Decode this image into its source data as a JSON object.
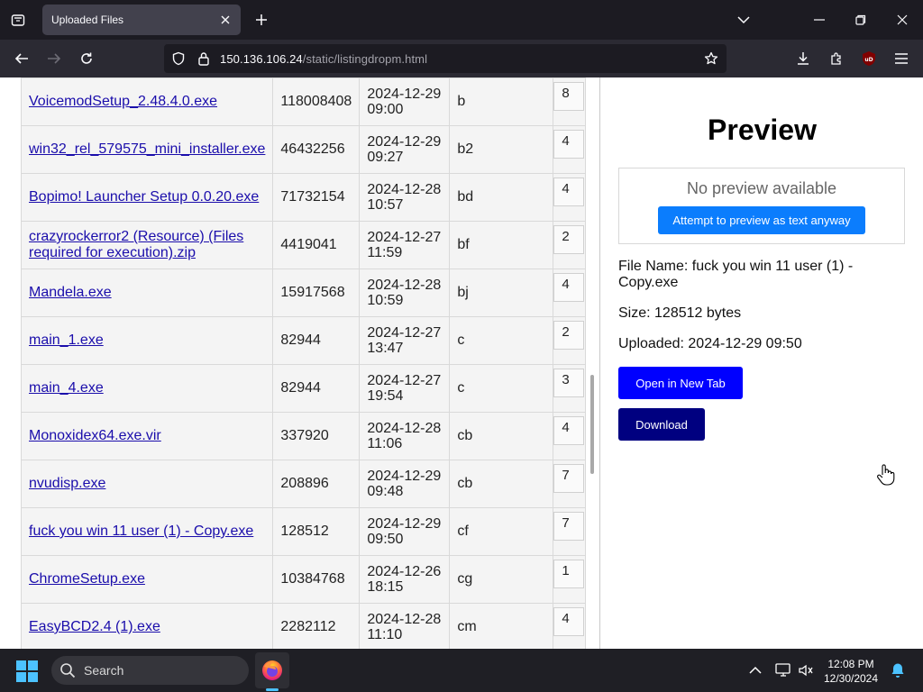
{
  "browser": {
    "tab_title": "Uploaded Files",
    "url_host": "150.136.106.24",
    "url_path": "/static/listingdropm.html"
  },
  "files": [
    {
      "name": "VoicemodSetup_2.48.4.0.exe",
      "size": "118008408",
      "date": "2024-12-29",
      "time": "09:00",
      "tag": "b",
      "count": "8"
    },
    {
      "name": "win32_rel_579575_mini_installer.exe",
      "size": "46432256",
      "date": "2024-12-29",
      "time": "09:27",
      "tag": "b2",
      "count": "4"
    },
    {
      "name": "Bopimo! Launcher Setup 0.0.20.exe",
      "size": "71732154",
      "date": "2024-12-28",
      "time": "10:57",
      "tag": "bd",
      "count": "4"
    },
    {
      "name": "crazyrockerror2 (Resource) (Files required for execution).zip",
      "size": "4419041",
      "date": "2024-12-27",
      "time": "11:59",
      "tag": "bf",
      "count": "2"
    },
    {
      "name": "Mandela.exe",
      "size": "15917568",
      "date": "2024-12-28",
      "time": "10:59",
      "tag": "bj",
      "count": "4"
    },
    {
      "name": "main_1.exe",
      "size": "82944",
      "date": "2024-12-27",
      "time": "13:47",
      "tag": "c",
      "count": "2"
    },
    {
      "name": "main_4.exe",
      "size": "82944",
      "date": "2024-12-27",
      "time": "19:54",
      "tag": "c",
      "count": "3"
    },
    {
      "name": "Monoxidex64.exe.vir",
      "size": "337920",
      "date": "2024-12-28",
      "time": "11:06",
      "tag": "cb",
      "count": "4"
    },
    {
      "name": "nvudisp.exe",
      "size": "208896",
      "date": "2024-12-29",
      "time": "09:48",
      "tag": "cb",
      "count": "7"
    },
    {
      "name": "fuck you win 11 user (1) - Copy.exe",
      "size": "128512",
      "date": "2024-12-29",
      "time": "09:50",
      "tag": "cf",
      "count": "7"
    },
    {
      "name": "ChromeSetup.exe",
      "size": "10384768",
      "date": "2024-12-26",
      "time": "18:15",
      "tag": "cg",
      "count": "1"
    },
    {
      "name": "EasyBCD2.4 (1).exe",
      "size": "2282112",
      "date": "2024-12-28",
      "time": "11:10",
      "tag": "cm",
      "count": "4"
    }
  ],
  "preview": {
    "title": "Preview",
    "no_preview": "No preview available",
    "attempt_label": "Attempt to preview as text anyway",
    "file_name": "File Name: fuck you win 11 user (1) - Copy.exe",
    "size": "Size: 128512 bytes",
    "uploaded": "Uploaded: 2024-12-29 09:50",
    "open_label": "Open in New Tab",
    "download_label": "Download"
  },
  "taskbar": {
    "search_label": "Search",
    "time": "12:08 PM",
    "date": "12/30/2024"
  },
  "colors": {
    "link": "#1a0dab",
    "attempt_button": "#0b7dfd",
    "open_button": "#0000ff",
    "download_button": "#000080"
  }
}
